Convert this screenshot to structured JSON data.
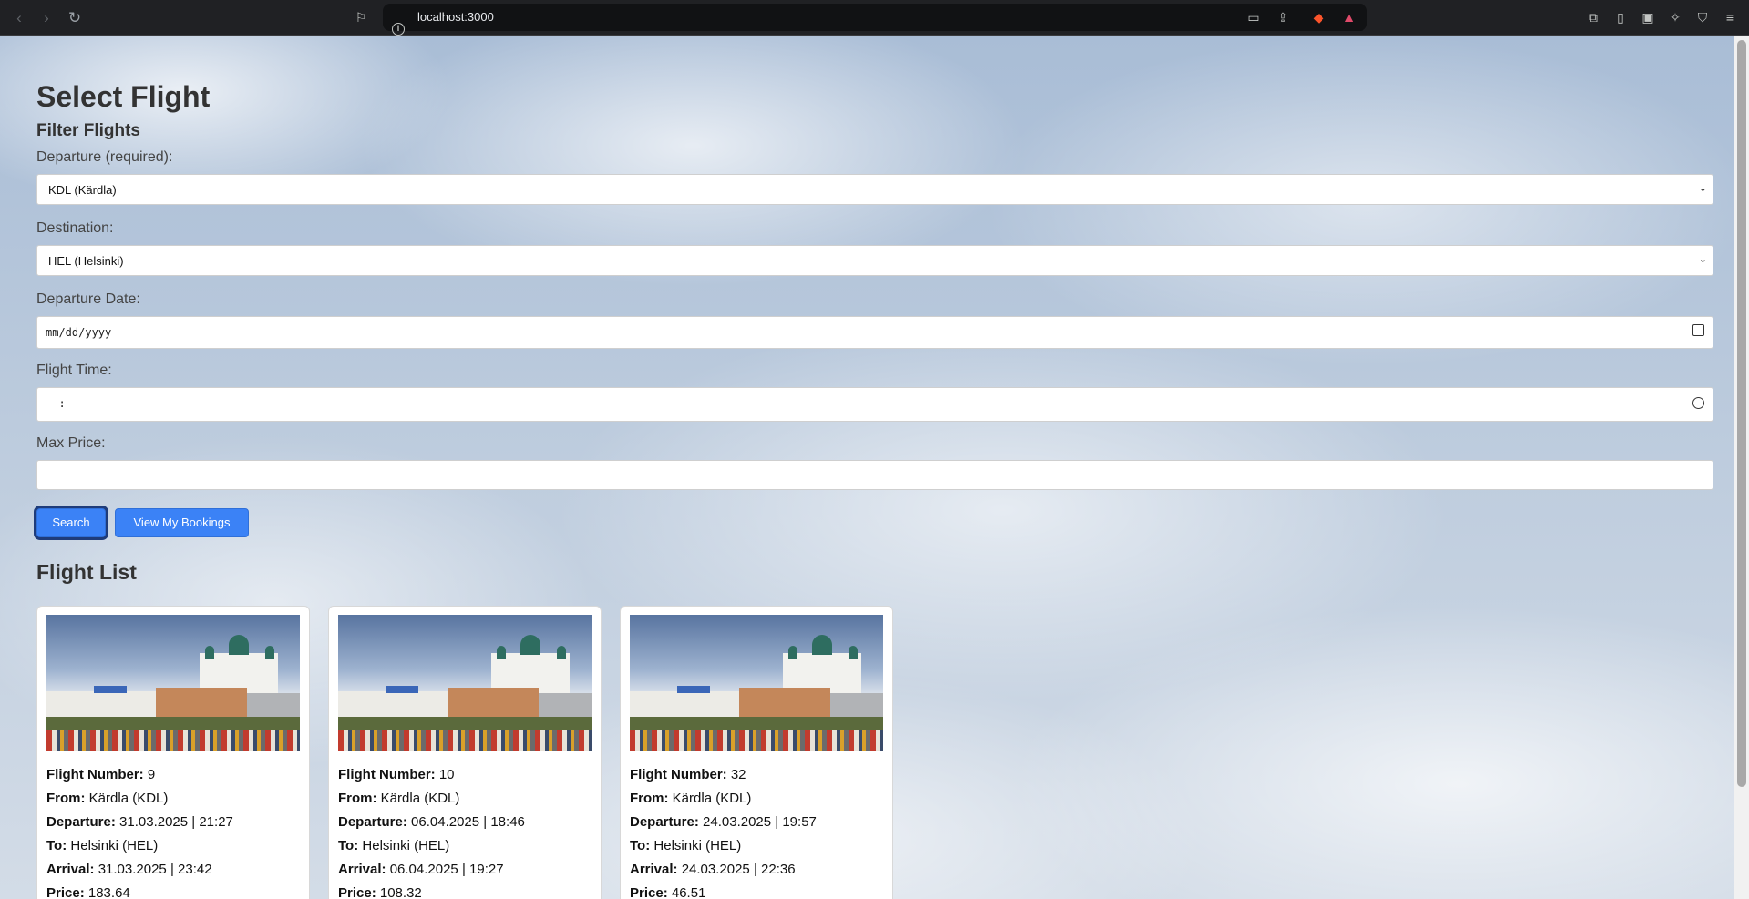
{
  "browser": {
    "url": "localhost:3000"
  },
  "page": {
    "title": "Select Flight",
    "filter_heading": "Filter Flights",
    "departure": {
      "label": "Departure (required):",
      "value": "KDL (Kärdla)"
    },
    "destination": {
      "label": "Destination:",
      "value": "HEL (Helsinki)"
    },
    "date": {
      "label": "Departure Date:",
      "placeholder": "mm/dd/yyyy"
    },
    "time": {
      "label": "Flight Time:",
      "placeholder": "--:-- --"
    },
    "max_price": {
      "label": "Max Price:",
      "value": ""
    },
    "buttons": {
      "search": "Search",
      "bookings": "View My Bookings"
    },
    "list_heading": "Flight List",
    "field_labels": {
      "number": "Flight Number:",
      "from": "From:",
      "departure": "Departure:",
      "to": "To:",
      "arrival": "Arrival:",
      "price": "Price:"
    },
    "flights": [
      {
        "number": "9",
        "from": "Kärdla (KDL)",
        "departure": "31.03.2025 | 21:27",
        "to": "Helsinki (HEL)",
        "arrival": "31.03.2025 | 23:42",
        "price": "183.64"
      },
      {
        "number": "10",
        "from": "Kärdla (KDL)",
        "departure": "06.04.2025 | 18:46",
        "to": "Helsinki (HEL)",
        "arrival": "06.04.2025 | 19:27",
        "price": "108.32"
      },
      {
        "number": "32",
        "from": "Kärdla (KDL)",
        "departure": "24.03.2025 | 19:57",
        "to": "Helsinki (HEL)",
        "arrival": "24.03.2025 | 22:36",
        "price": "46.51"
      }
    ]
  },
  "colors": {
    "button": "#3b82f6",
    "text": "#333333"
  }
}
